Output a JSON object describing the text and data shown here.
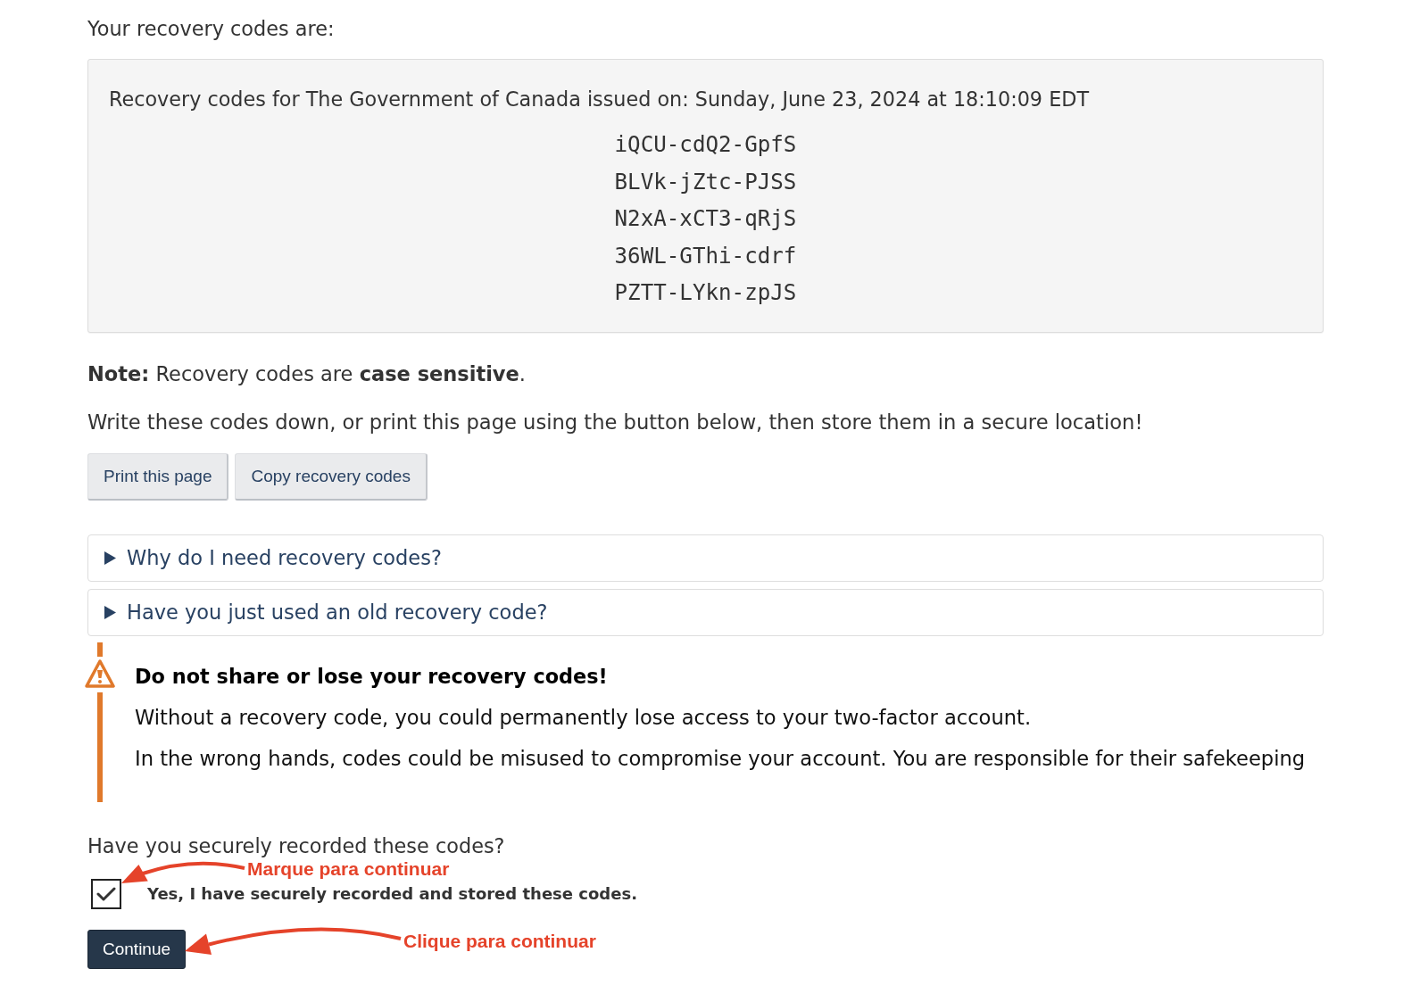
{
  "intro": "Your recovery codes are:",
  "codes_box": {
    "heading": "Recovery codes for The Government of Canada issued on: Sunday, June 23, 2024 at 18:10:09 EDT",
    "codes": [
      "iQCU-cdQ2-GpfS",
      "BLVk-jZtc-PJSS",
      "N2xA-xCT3-qRjS",
      "36WL-GThi-cdrf",
      "PZTT-LYkn-zpJS"
    ]
  },
  "note": "**Note:** Recovery codes are **case sensitive**.",
  "instruction": "Write these codes down, or print this page using the button below, then store them in a secure location!",
  "buttons": [
    "Print this page",
    "Copy recovery codes"
  ],
  "details": [
    {
      "summary": "Why do I need recovery codes?",
      "expanded": false
    },
    {
      "summary": "Have you just used an old recovery code?",
      "expanded": false
    }
  ],
  "warning": {
    "title": "Do not share or lose your recovery codes!",
    "paragraphs": [
      "Without a recovery code, you could permanently lose access to your two-factor account.",
      "In the wrong hands, codes could be misused to compromise your account. You are responsible for their safekeeping"
    ]
  },
  "confirmation": {
    "question": "Have you securely recorded these codes?",
    "checkbox": {
      "label": "Yes, I have securely recorded and stored these codes.",
      "checked": true
    }
  },
  "continue_button": "Continue",
  "annotations": [
    {
      "text": "Marque para continuar"
    },
    {
      "text": "Clique para continuar"
    }
  ]
}
